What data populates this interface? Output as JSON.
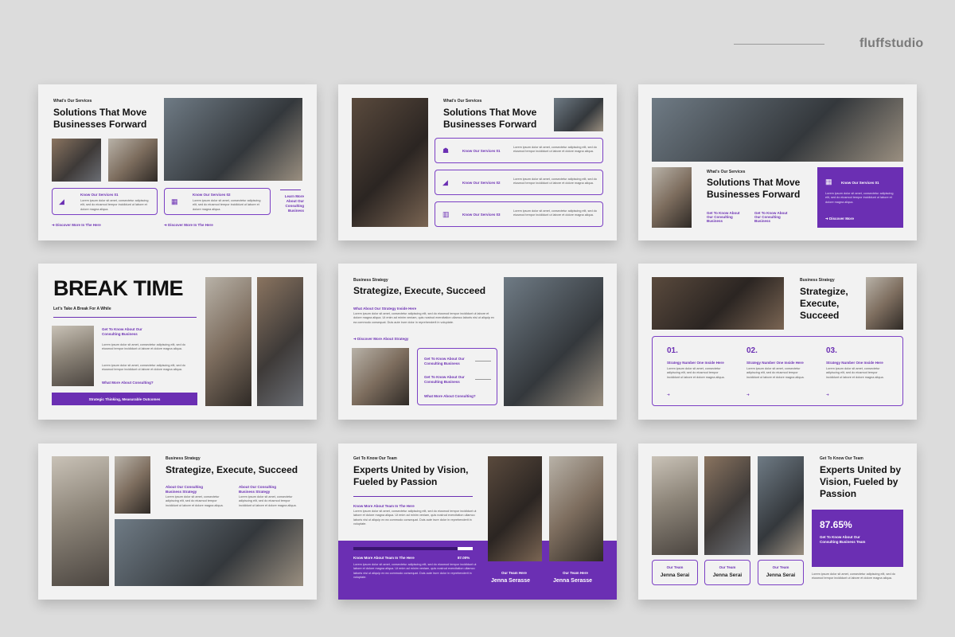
{
  "brand": "fluffstudio",
  "lorem": "Lorem ipsum dolor sit amet, consectetur adipiscing elit, sed do eiusmod tempor incididunt ut labore et dolore magna aliqua.",
  "lorem_long": "Lorem ipsum dolor sit amet, consectetur adipiscing elit, sed do eiusmod tempor incididunt ut labore et dolore magna aliqua. Ut enim ad minim veniam, quis nostrud exercitation ullamco laboris nisi ut aliquip ex ea commodo consequat. Duis aute irure dolor in reprehenderit in voluptate.",
  "s1": {
    "kicker": "What's Our Services",
    "title": "Solutions That Move Businesses Forward",
    "svc1": "Know Our Services 01",
    "svc2": "Know Our Services 02",
    "learn": "Learn More About Our Consulting Business",
    "discover": "Discover More In The Here",
    "discover2": "Discover More In The Here"
  },
  "s2": {
    "kicker": "What's Our Services",
    "title": "Solutions That Move Businesses Forward",
    "svc1": "Know Our Services 01",
    "svc2": "Know Our Services 02",
    "svc3": "Know Our Services 03"
  },
  "s3": {
    "kicker": "What's Our Services",
    "title": "Solutions That Move Businesses Forward",
    "get1": "Get To Know About Our Consulting Business",
    "get2": "Get To Know About Our Consulting Business",
    "svc": "Know Our Services 01",
    "discover": "Discover More"
  },
  "s4": {
    "title": "BREAK TIME",
    "sub": "Let's Take A Break For A While",
    "get": "Get To Know About Our Consulting Business",
    "what": "What More About Consulting?",
    "banner": "Strategic Thinking, Measurable Outcomes"
  },
  "s5": {
    "kicker": "Business Strategy",
    "title": "Strategize, Execute, Succeed",
    "what": "What About Our Strategy Inside Here",
    "discover": "Discover More About Strategy",
    "get1": "Get To Know About Our Consulting Business",
    "get2": "Get To Know About Our Consulting Business",
    "what2": "What More About Consulting?"
  },
  "s6": {
    "kicker": "Business Strategy",
    "title": "Strategize, Execute, Succeed",
    "n1": "01.",
    "n2": "02.",
    "n3": "03.",
    "l1": "Strategy Number One Inside Here",
    "l2": "Strategy Number One Inside Here",
    "l3": "Strategy Number One Inside Here"
  },
  "s7": {
    "kicker": "Business Strategy",
    "title": "Strategize, Execute, Succeed",
    "a1": "About Our Consulting Business Strategy",
    "a2": "About Our Consulting Business Strategy"
  },
  "s8": {
    "kicker": "Get To Know Our Team",
    "title": "Experts United by Vision, Fueled by Passion",
    "know": "Know More About Team In The Here",
    "bar_label": "Know More About Team In The Here",
    "bar_value": "87.00%",
    "bar_fraction": 0.87,
    "role1": "Our Team Here",
    "name1": "Jenna Serasse",
    "role2": "Our Team Here",
    "name2": "Jenna Serasse"
  },
  "s9": {
    "kicker": "Get To Know Our Team",
    "title": "Experts United by Vision, Fueled by Passion",
    "stat": "87.65%",
    "stat_label": "Get To Know About Our Consulting Business Team",
    "role": "Our Team",
    "n1": "Jenna Serai",
    "n2": "Jenna Serai",
    "n3": "Jenna Serai"
  }
}
